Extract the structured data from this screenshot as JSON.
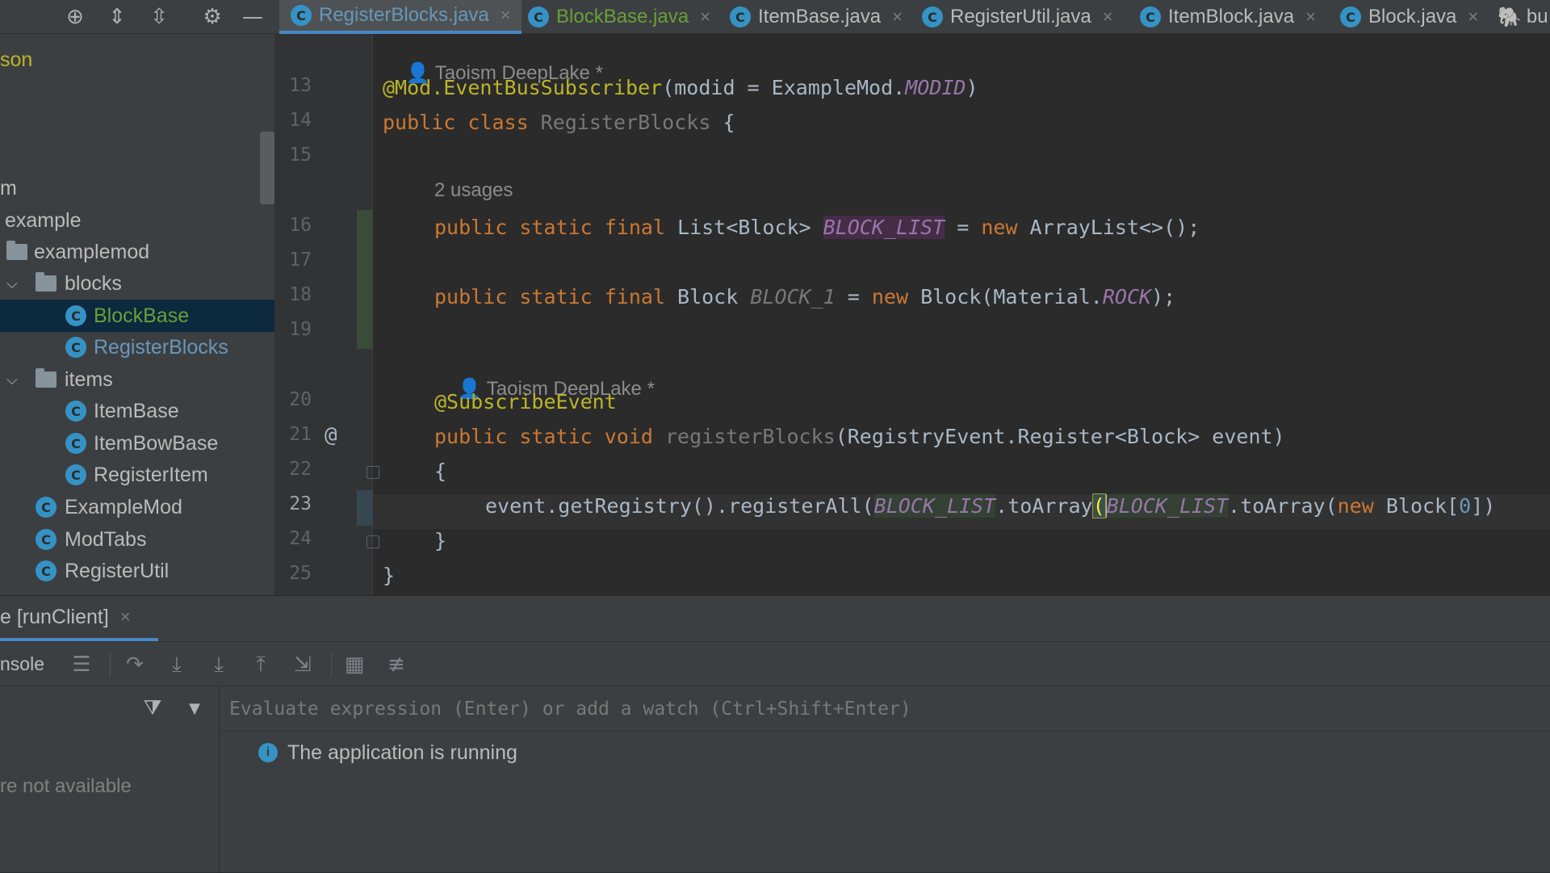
{
  "project_tree": {
    "fragment_1": "son",
    "fragment_2": "m",
    "items": [
      {
        "label": "example"
      },
      {
        "label": "examplemod"
      },
      {
        "label": "blocks"
      },
      {
        "label": "BlockBase"
      },
      {
        "label": "RegisterBlocks"
      },
      {
        "label": "items"
      },
      {
        "label": "ItemBase"
      },
      {
        "label": "ItemBowBase"
      },
      {
        "label": "RegisterItem"
      },
      {
        "label": "ExampleMod"
      },
      {
        "label": "ModTabs"
      },
      {
        "label": "RegisterUtil"
      }
    ]
  },
  "tabs": [
    {
      "label": "RegisterBlocks.java",
      "active": true
    },
    {
      "label": "BlockBase.java"
    },
    {
      "label": "ItemBase.java"
    },
    {
      "label": "RegisterUtil.java"
    },
    {
      "label": "ItemBlock.java"
    },
    {
      "label": "Block.java"
    },
    {
      "label": "bu"
    }
  ],
  "editor": {
    "author_hint_1": "Taoism DeepLake *",
    "usages_hint": "2 usages",
    "author_hint_2": "Taoism DeepLake *",
    "line_numbers": [
      "13",
      "14",
      "15",
      "16",
      "17",
      "18",
      "19",
      "20",
      "21",
      "22",
      "23",
      "24",
      "25"
    ],
    "gutter_annotation": "@",
    "tokens": {
      "l13_ann": "@Mod.EventBusSubscriber",
      "l13_a": "(modid = ExampleMod.",
      "l13_field": "MODID",
      "l13_b": ")",
      "l14_kw": "public class ",
      "l14_name": "RegisterBlocks",
      "l14_b": " {",
      "l16_kw": "public static final ",
      "l16_a": "List<Block> ",
      "l16_field": "BLOCK_LIST",
      "l16_b": " = ",
      "l16_new": "new ",
      "l16_c": "ArrayList<>();",
      "l18_kw": "public static final ",
      "l18_a": "Block ",
      "l18_field": "BLOCK_1",
      "l18_b": " = ",
      "l18_new": "new ",
      "l18_c": "Block(Material.",
      "l18_field2": "ROCK",
      "l18_d": ");",
      "l20_ann": "@SubscribeEvent",
      "l21_kw": "public static void ",
      "l21_name": "registerBlocks",
      "l21_a": "(RegistryEvent.Register<Block> event)",
      "l22": "{",
      "l23_a": "event.getRegistry().registerAll(",
      "l23_field": "BLOCK_LIST",
      "l23_b": ".toArray",
      "l23_paren": "(",
      "l23_field2": "BLOCK_LIST",
      "l23_c": ".toArray(",
      "l23_new": "new ",
      "l23_d": "Block[",
      "l23_num": "0",
      "l23_e": "])",
      "l24": "}",
      "l25": "}"
    }
  },
  "bottom": {
    "run_tab_label": "e [runClient]",
    "console_label": "nsole",
    "frames_unavailable": "re not available",
    "watch_placeholder": "Evaluate expression (Enter) or add a watch (Ctrl+Shift+Enter)",
    "status_text": "The application is running"
  },
  "colors": {
    "accent": "#4a88c7",
    "class_icon": "#3592c4",
    "selection": "#0d293e"
  }
}
